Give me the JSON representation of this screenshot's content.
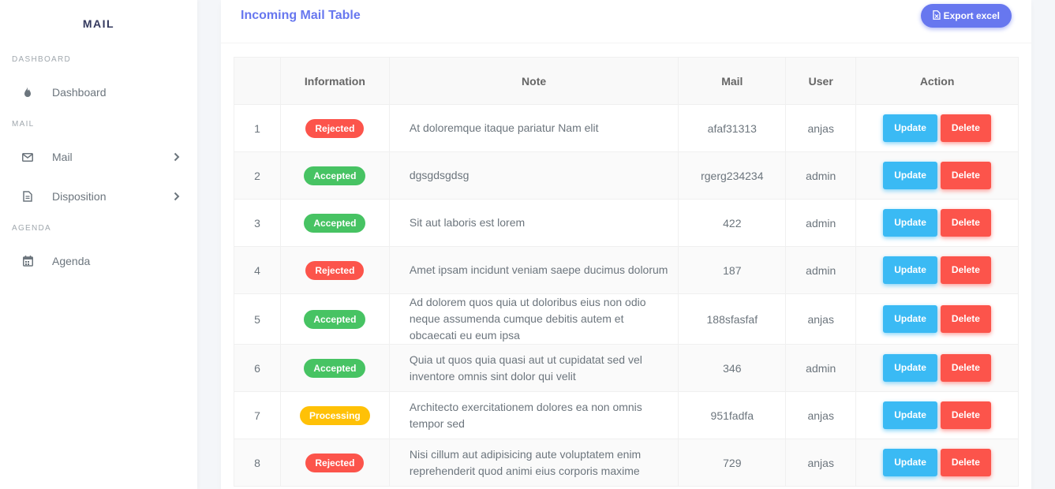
{
  "app": {
    "brand": "MAIL"
  },
  "sidebar": {
    "sections": [
      {
        "header": "DASHBOARD",
        "items": [
          {
            "label": "Dashboard",
            "icon": "fire-icon",
            "has_children": false
          }
        ]
      },
      {
        "header": "MAIL",
        "items": [
          {
            "label": "Mail",
            "icon": "envelope-icon",
            "has_children": true
          },
          {
            "label": "Disposition",
            "icon": "file-icon",
            "has_children": true
          }
        ]
      },
      {
        "header": "AGENDA",
        "items": [
          {
            "label": "Agenda",
            "icon": "calendar-icon",
            "has_children": false
          }
        ]
      }
    ]
  },
  "main": {
    "title": "Incoming Mail Table",
    "export_label": "Export excel",
    "table": {
      "headers": [
        "",
        "Information",
        "Note",
        "Mail",
        "User",
        "Action"
      ],
      "update_label": "Update",
      "delete_label": "Delete",
      "rows": [
        {
          "no": "1",
          "status": "Rejected",
          "note": "At doloremque itaque pariatur Nam elit",
          "mail": "afaf31313",
          "user": "anjas"
        },
        {
          "no": "2",
          "status": "Accepted",
          "note": "dgsgdsgdsg",
          "mail": "rgerg234234",
          "user": "admin"
        },
        {
          "no": "3",
          "status": "Accepted",
          "note": "Sit aut laboris est lorem",
          "mail": "422",
          "user": "admin"
        },
        {
          "no": "4",
          "status": "Rejected",
          "note": "Amet ipsam incidunt veniam saepe ducimus dolorum",
          "mail": "187",
          "user": "admin"
        },
        {
          "no": "5",
          "status": "Accepted",
          "note": "Ad dolorem quos quia ut doloribus eius non odio neque assumenda cumque debitis autem et obcaecati eu eum ipsa",
          "mail": "188sfasfaf",
          "user": "anjas"
        },
        {
          "no": "6",
          "status": "Accepted",
          "note": "Quia ut quos quia quasi aut ut cupidatat sed vel inventore omnis sint dolor qui velit",
          "mail": "346",
          "user": "admin"
        },
        {
          "no": "7",
          "status": "Processing",
          "note": "Architecto exercitationem dolores ea non omnis tempor sed",
          "mail": "951fadfa",
          "user": "anjas"
        },
        {
          "no": "8",
          "status": "Rejected",
          "note": "Nisi cillum aut adipisicing aute voluptatem enim reprehenderit quod animi eius corporis maxime",
          "mail": "729",
          "user": "anjas"
        }
      ]
    }
  },
  "colors": {
    "primary": "#6777ef",
    "info": "#3abaf4",
    "danger": "#fc544b",
    "success": "#47c363",
    "warning": "#ffc107"
  }
}
